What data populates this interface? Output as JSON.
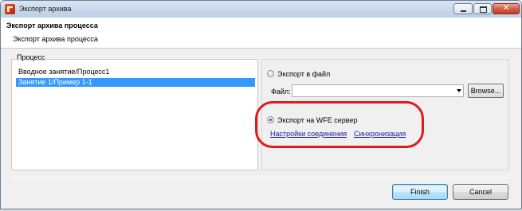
{
  "window": {
    "title": "Экспорт архива"
  },
  "header": {
    "title": "Экспорт архива процесса",
    "subtitle": "Экспорт архива процесса"
  },
  "process_group": {
    "label": "Процесс",
    "items": [
      {
        "label": "Вводное занятие/Процесс1",
        "selected": false
      },
      {
        "label": "Занятие 1/Пример 1-1",
        "selected": true
      }
    ]
  },
  "export_options": {
    "to_file": {
      "label": "Экспорт в файл",
      "checked": false
    },
    "file_label": "Файл:",
    "file_value": "",
    "browse_label": "Browse...",
    "to_server": {
      "label": "Экспорт на WFE сервер",
      "checked": true
    },
    "links": [
      "Настройки соединения",
      "Синхронизация"
    ]
  },
  "footer": {
    "finish_label": "Finish",
    "cancel_label": "Cancel"
  },
  "colors": {
    "selection": "#3399ff",
    "link": "#1a1aa6",
    "annotation": "#e01a1a"
  }
}
